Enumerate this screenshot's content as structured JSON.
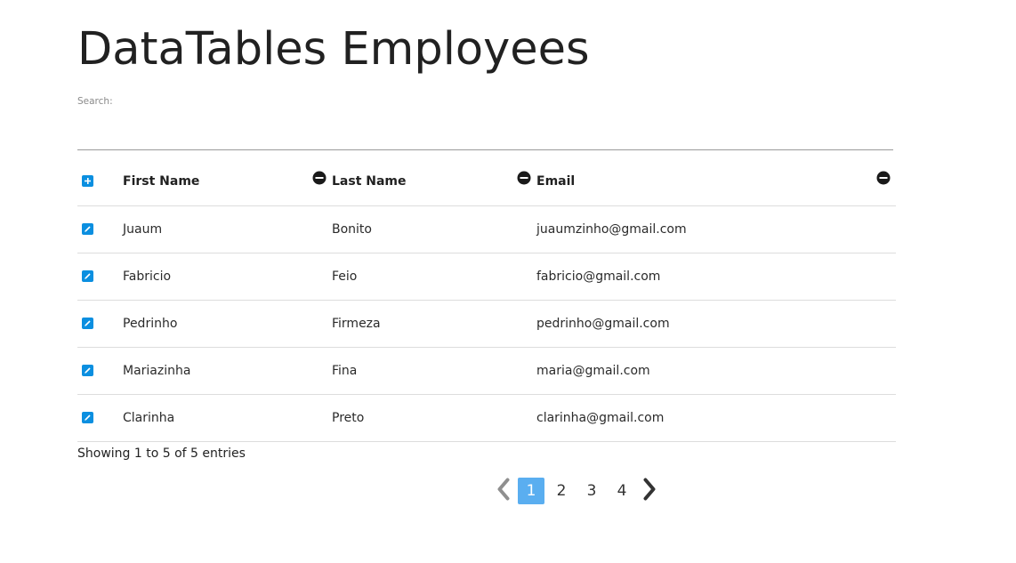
{
  "page": {
    "title": "DataTables Employees"
  },
  "search": {
    "label": "Search:",
    "value": "",
    "placeholder": ""
  },
  "table": {
    "columns": [
      "First Name",
      "Last Name",
      "Email"
    ],
    "header_control_icon": "plus-square-icon",
    "column_hide_icon": "minus-circle-icon",
    "row_control_icon": "edit-pencil-icon",
    "rows": [
      {
        "first": "Juaum",
        "last": "Bonito",
        "email": "juaumzinho@gmail.com"
      },
      {
        "first": "Fabricio",
        "last": "Feio",
        "email": "fabricio@gmail.com"
      },
      {
        "first": "Pedrinho",
        "last": "Firmeza",
        "email": "pedrinho@gmail.com"
      },
      {
        "first": "Mariazinha",
        "last": "Fina",
        "email": "maria@gmail.com"
      },
      {
        "first": "Clarinha",
        "last": "Preto",
        "email": "clarinha@gmail.com"
      }
    ]
  },
  "info": {
    "text": "Showing 1 to 5 of 5 entries"
  },
  "pagination": {
    "prev_icon": "chevron-left-icon",
    "next_icon": "chevron-right-icon",
    "pages": [
      "1",
      "2",
      "3",
      "4"
    ],
    "active": "1"
  },
  "colors": {
    "accent": "#0b8fe0",
    "active_page": "#5aaef0",
    "border": "#dddddd"
  }
}
